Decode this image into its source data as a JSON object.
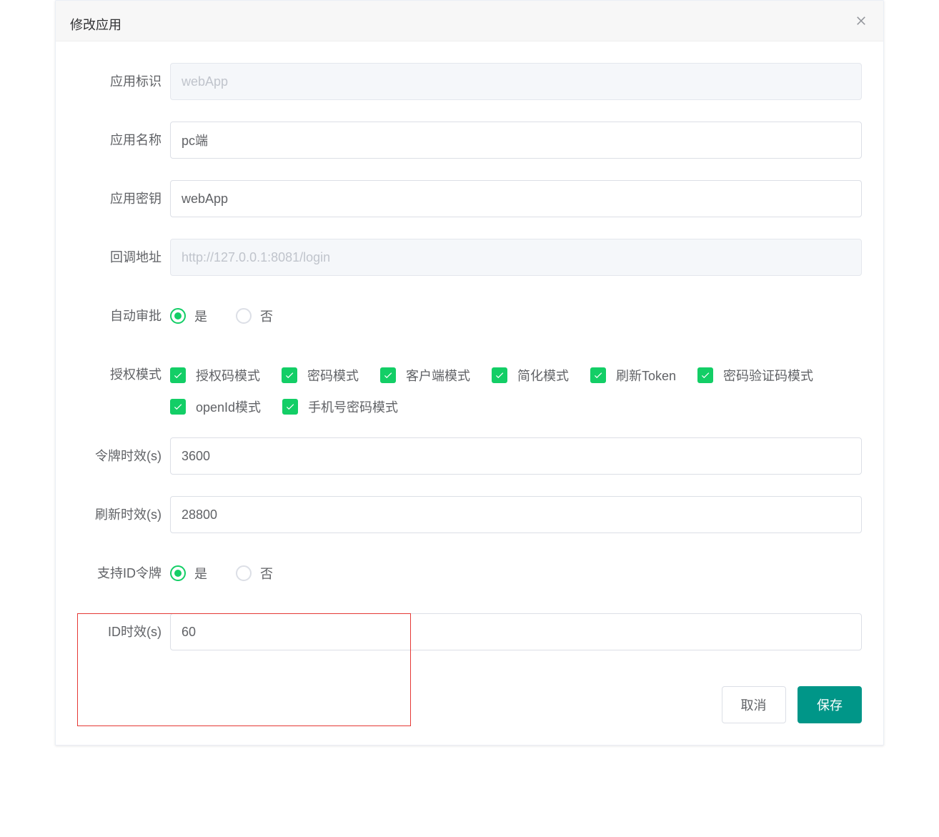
{
  "dialog": {
    "title": "修改应用"
  },
  "labels": {
    "appId": "应用标识",
    "appName": "应用名称",
    "appSecret": "应用密钥",
    "callback": "回调地址",
    "autoApprove": "自动审批",
    "grantTypes": "授权模式",
    "tokenValidity": "令牌时效(s)",
    "refreshValidity": "刷新时效(s)",
    "supportIdToken": "支持ID令牌",
    "idValidity": "ID时效(s)"
  },
  "values": {
    "appId": "",
    "appIdPlaceholder": "webApp",
    "appName": "pc端",
    "appSecret": "webApp",
    "callback": "",
    "callbackPlaceholder": "http://127.0.0.1:8081/login",
    "tokenValidity": "3600",
    "refreshValidity": "28800",
    "idValidity": "60"
  },
  "radio": {
    "yes": "是",
    "no": "否"
  },
  "grantTypes": [
    "授权码模式",
    "密码模式",
    "客户端模式",
    "简化模式",
    "刷新Token",
    "密码验证码模式",
    "openId模式",
    "手机号密码模式"
  ],
  "buttons": {
    "cancel": "取消",
    "save": "保存"
  }
}
